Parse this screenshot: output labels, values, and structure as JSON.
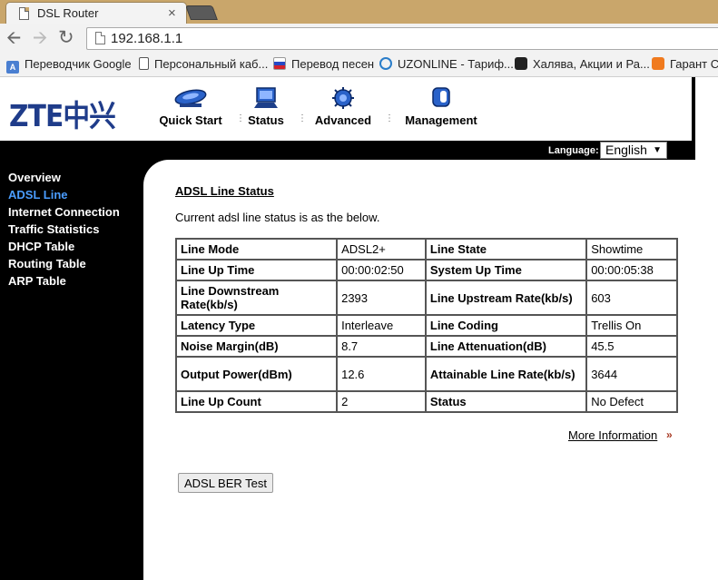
{
  "browser": {
    "tab_title": "DSL Router",
    "tab_close": "×",
    "url": "192.168.1.1",
    "bookmarks": [
      {
        "label": "Переводчик Google",
        "icon": "google-translate-icon"
      },
      {
        "label": "Персональный каб...",
        "icon": "page-icon"
      },
      {
        "label": "Перевод песен",
        "icon": "russia-flag-icon"
      },
      {
        "label": "UZONLINE - Тариф...",
        "icon": "uzonline-icon"
      },
      {
        "label": "Халява, Акции и Ра...",
        "icon": "halyava-icon"
      },
      {
        "label": "Гарант Се",
        "icon": "garant-icon"
      }
    ]
  },
  "router": {
    "logo": "ZTE中兴",
    "menu": [
      {
        "label": "Quick Start",
        "icon": "quick-start-icon"
      },
      {
        "label": "Status",
        "icon": "status-monitor-icon"
      },
      {
        "label": "Advanced",
        "icon": "advanced-gear-icon"
      },
      {
        "label": "Management",
        "icon": "management-icon"
      }
    ],
    "language_label": "Language:",
    "language_value": "English",
    "sidebar": [
      {
        "label": "Overview",
        "active": false
      },
      {
        "label": "ADSL Line",
        "active": true
      },
      {
        "label": "Internet Connection",
        "active": false
      },
      {
        "label": "Traffic Statistics",
        "active": false
      },
      {
        "label": "DHCP Table",
        "active": false
      },
      {
        "label": "Routing Table",
        "active": false
      },
      {
        "label": "ARP Table",
        "active": false
      }
    ],
    "section_title": "ADSL Line Status",
    "intro": "Current adsl line status is as the below.",
    "table": [
      [
        "Line Mode",
        "ADSL2+",
        "Line State",
        "Showtime"
      ],
      [
        "Line Up Time",
        "00:00:02:50",
        "System Up Time",
        "00:00:05:38"
      ],
      [
        "Line Downstream Rate(kb/s)",
        "2393",
        "Line Upstream Rate(kb/s)",
        "603"
      ],
      [
        "Latency Type",
        "Interleave",
        "Line Coding",
        "Trellis On"
      ],
      [
        "Noise Margin(dB)",
        "8.7",
        "Line Attenuation(dB)",
        "45.5"
      ],
      [
        "Output Power(dBm)",
        "12.6",
        "Attainable Line Rate(kb/s)",
        "3644"
      ],
      [
        "Line Up Count",
        "2",
        "Status",
        "No Defect"
      ]
    ],
    "more_info": "More Information",
    "ber_button": "ADSL BER Test"
  }
}
